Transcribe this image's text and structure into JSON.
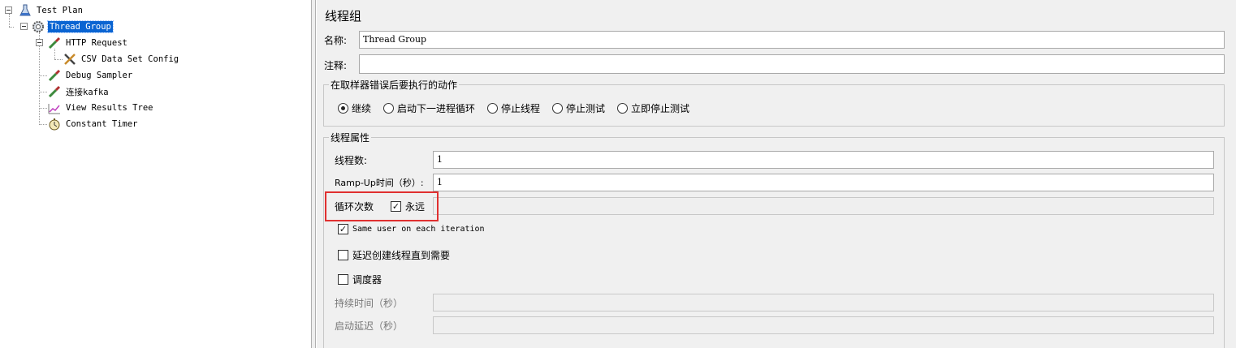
{
  "tree": {
    "nodes": [
      {
        "label": "Test Plan",
        "icon": "flask-icon"
      },
      {
        "label": "Thread Group",
        "icon": "gear-icon"
      },
      {
        "label": "HTTP Request",
        "icon": "pipette-icon"
      },
      {
        "label": "CSV Data Set Config",
        "icon": "tools-icon"
      },
      {
        "label": "Debug Sampler",
        "icon": "pipette-icon"
      },
      {
        "label": "连接kafka",
        "icon": "pipette-icon"
      },
      {
        "label": "View Results Tree",
        "icon": "chart-icon"
      },
      {
        "label": "Constant Timer",
        "icon": "stopwatch-icon"
      }
    ],
    "selected_index": 1
  },
  "panel": {
    "title": "线程组",
    "name_label": "名称:",
    "name_value": "Thread Group",
    "comment_label": "注释:",
    "comment_value": "",
    "sampler_error": {
      "legend": "在取样器错误后要执行的动作",
      "options": [
        "继续",
        "启动下一进程循环",
        "停止线程",
        "停止测试",
        "立即停止测试"
      ],
      "selected": "继续"
    },
    "thread_props": {
      "legend": "线程属性",
      "threads_label": "线程数:",
      "threads_value": "1",
      "rampup_label": "Ramp-Up时间（秒）:",
      "rampup_value": "1",
      "loop_label": "循环次数",
      "forever_label": "永远",
      "forever_checked": true,
      "same_user_label": "Same user on each iteration",
      "same_user_checked": true,
      "delay_label": "延迟创建线程直到需要",
      "delay_checked": false,
      "scheduler_label": "调度器",
      "scheduler_checked": false,
      "duration_label": "持续时间（秒）",
      "startup_delay_label": "启动延迟（秒）"
    }
  },
  "colors": {
    "selection": "#0a64d2",
    "highlight_box": "#e03030",
    "panel_bg": "#f0f0f0"
  }
}
